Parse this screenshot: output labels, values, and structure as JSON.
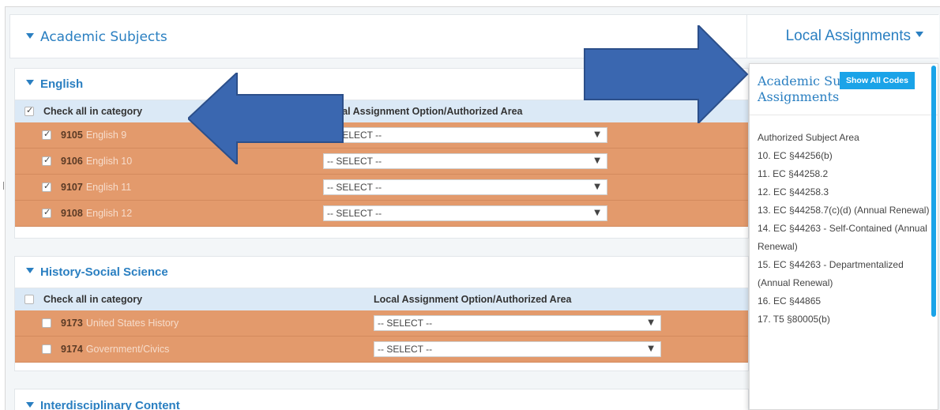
{
  "academic_panel": {
    "title": "Academic Subjects"
  },
  "local_tab": {
    "label": "Local Assignments"
  },
  "sections": {
    "english": {
      "title": "English",
      "check_all": "Check all in category",
      "column_header": "Local Assignment Option/Authorized Area",
      "rows": [
        {
          "code": "9105",
          "name": "English 9",
          "select": "-- SELECT --"
        },
        {
          "code": "9106",
          "name": "English 10",
          "select": "-- SELECT --"
        },
        {
          "code": "9107",
          "name": "English 11",
          "select": "-- SELECT --"
        },
        {
          "code": "9108",
          "name": "English 12",
          "select": "-- SELECT --"
        }
      ]
    },
    "history": {
      "title": "History-Social Science",
      "check_all": "Check all in category",
      "column_header": "Local Assignment Option/Authorized Area",
      "rows": [
        {
          "code": "9173",
          "name": "United States History",
          "select": "-- SELECT --"
        },
        {
          "code": "9174",
          "name": "Government/Civics",
          "select": "-- SELECT --"
        }
      ]
    },
    "interdisciplinary": {
      "title": "Interdisciplinary Content"
    }
  },
  "dropdown": {
    "title": "Academic Subject Assignments",
    "show_all": "Show All Codes",
    "items": [
      "Authorized Subject Area",
      "10. EC §44256(b)",
      "11. EC §44258.2",
      "12. EC §44258.3",
      "13. EC §44258.7(c)(d) (Annual Renewal)",
      "14. EC §44263 - Self-Contained (Annual Renewal)",
      "15. EC §44263 - Departmentalized (Annual Renewal)",
      "16. EC §44865",
      "17. T5 §80005(b)"
    ]
  },
  "colors": {
    "accent": "#2a7fc1",
    "row_orange": "#e39a6c",
    "header_blue": "#dbe9f6",
    "arrow_blue": "#3a67b0",
    "show_all_bg": "#1aa3e8"
  }
}
